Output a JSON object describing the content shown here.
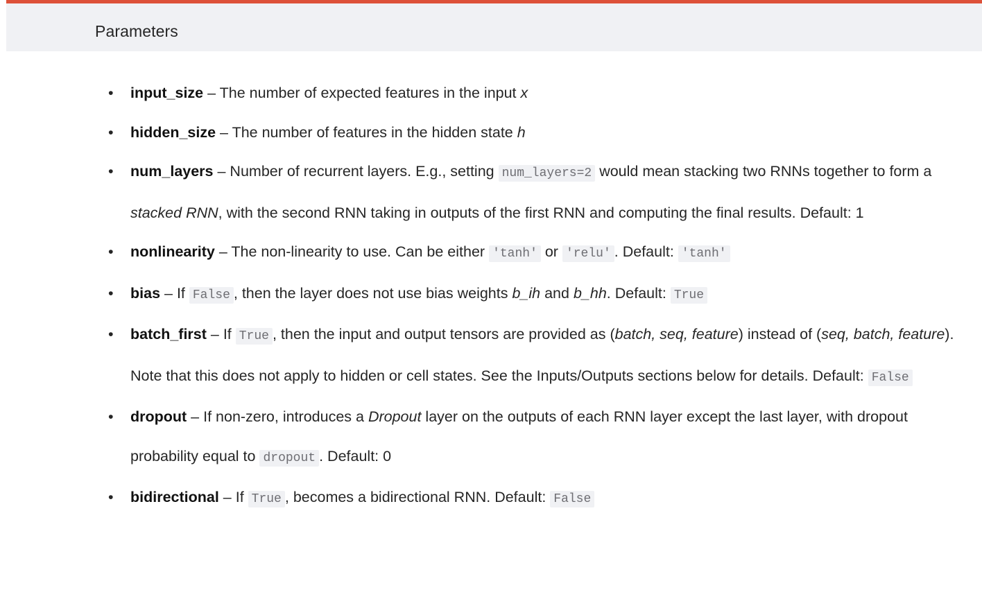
{
  "section": {
    "title": "Parameters",
    "accent_color": "#dd5139",
    "header_bg": "#f0f1f4",
    "text_color": "#262626",
    "code_bg": "#f0f1f4",
    "code_color": "#6e6e73"
  },
  "bullet_glyph": "•",
  "dash": "–",
  "parameters": [
    {
      "name": "input_size",
      "parts": [
        {
          "type": "text",
          "value": "The number of expected features in the input "
        },
        {
          "type": "em",
          "value": "x"
        }
      ]
    },
    {
      "name": "hidden_size",
      "parts": [
        {
          "type": "text",
          "value": "The number of features in the hidden state "
        },
        {
          "type": "em",
          "value": "h"
        }
      ]
    },
    {
      "name": "num_layers",
      "parts": [
        {
          "type": "text",
          "value": "Number of recurrent layers. E.g., setting "
        },
        {
          "type": "code",
          "value": "num_layers=2"
        },
        {
          "type": "text",
          "value": " would mean stacking two RNNs together to form a "
        },
        {
          "type": "em",
          "value": "stacked RNN"
        },
        {
          "type": "text",
          "value": ", with the second RNN taking in outputs of the first RNN and computing the final results. Default: 1"
        }
      ]
    },
    {
      "name": "nonlinearity",
      "parts": [
        {
          "type": "text",
          "value": "The non-linearity to use. Can be either "
        },
        {
          "type": "code",
          "value": "'tanh'"
        },
        {
          "type": "text",
          "value": " or "
        },
        {
          "type": "code",
          "value": "'relu'"
        },
        {
          "type": "text",
          "value": ". Default: "
        },
        {
          "type": "code",
          "value": "'tanh'"
        }
      ]
    },
    {
      "name": "bias",
      "parts": [
        {
          "type": "text",
          "value": "If "
        },
        {
          "type": "code",
          "value": "False"
        },
        {
          "type": "text",
          "value": ", then the layer does not use bias weights "
        },
        {
          "type": "em",
          "value": "b_ih"
        },
        {
          "type": "text",
          "value": " and "
        },
        {
          "type": "em",
          "value": "b_hh"
        },
        {
          "type": "text",
          "value": ". Default: "
        },
        {
          "type": "code",
          "value": "True"
        }
      ]
    },
    {
      "name": "batch_first",
      "parts": [
        {
          "type": "text",
          "value": "If "
        },
        {
          "type": "code",
          "value": "True"
        },
        {
          "type": "text",
          "value": ", then the input and output tensors are provided as ("
        },
        {
          "type": "em",
          "value": "batch, seq, feature"
        },
        {
          "type": "text",
          "value": ") instead of ("
        },
        {
          "type": "em",
          "value": "seq, batch, feature"
        },
        {
          "type": "text",
          "value": "). Note that this does not apply to hidden or cell states. See the Inputs/Outputs sections below for details. Default: "
        },
        {
          "type": "code",
          "value": "False"
        }
      ]
    },
    {
      "name": "dropout",
      "parts": [
        {
          "type": "text",
          "value": "If non-zero, introduces a "
        },
        {
          "type": "em",
          "value": "Dropout"
        },
        {
          "type": "text",
          "value": " layer on the outputs of each RNN layer except the last layer, with dropout probability equal to "
        },
        {
          "type": "code",
          "value": "dropout"
        },
        {
          "type": "text",
          "value": ". Default: 0"
        }
      ]
    },
    {
      "name": "bidirectional",
      "parts": [
        {
          "type": "text",
          "value": "If "
        },
        {
          "type": "code",
          "value": "True"
        },
        {
          "type": "text",
          "value": ", becomes a bidirectional RNN. Default: "
        },
        {
          "type": "code",
          "value": "False"
        }
      ]
    }
  ]
}
